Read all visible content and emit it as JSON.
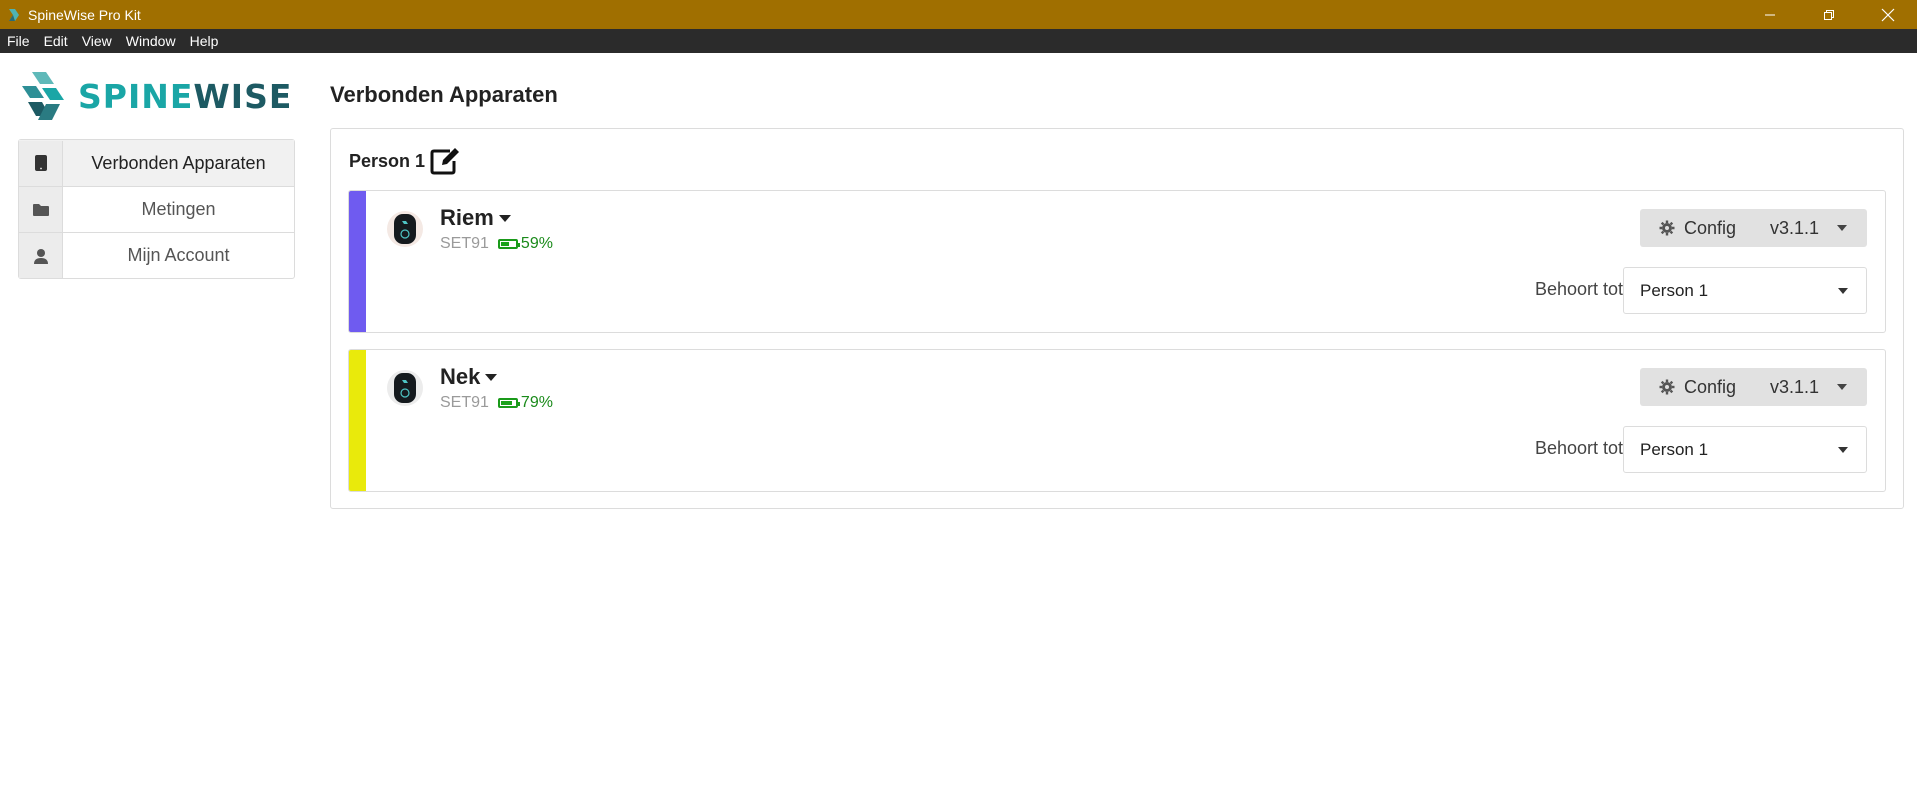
{
  "window": {
    "title": "SpineWise Pro Kit",
    "controls": [
      "minimize-icon",
      "restore-icon",
      "close-icon"
    ]
  },
  "menu": [
    "File",
    "Edit",
    "View",
    "Window",
    "Help"
  ],
  "logo": {
    "part1": "SPINE",
    "part2": "WISE",
    "colors": {
      "spine": "#1aa6a6",
      "wise": "#1d5a63"
    }
  },
  "sidebar": {
    "items": [
      {
        "label": "Verbonden Apparaten",
        "icon": "tablet-icon",
        "active": true
      },
      {
        "label": "Metingen",
        "icon": "folder-icon",
        "active": false
      },
      {
        "label": "Mijn Account",
        "icon": "user-icon",
        "active": false
      }
    ]
  },
  "main": {
    "title": "Verbonden Apparaten",
    "group": {
      "name": "Person 1",
      "devices": [
        {
          "name": "Riem",
          "serial": "SET91",
          "battery": "59%",
          "battery_level": 0.59,
          "color": "#6f5bf0",
          "config_label": "Config",
          "version": "v3.1.1",
          "owner_label": "Behoort tot",
          "owner_value": "Person 1"
        },
        {
          "name": "Nek",
          "serial": "SET91",
          "battery": "79%",
          "battery_level": 0.79,
          "color": "#e9ea0b",
          "config_label": "Config",
          "version": "v3.1.1",
          "owner_label": "Behoort tot",
          "owner_value": "Person 1"
        }
      ]
    }
  }
}
